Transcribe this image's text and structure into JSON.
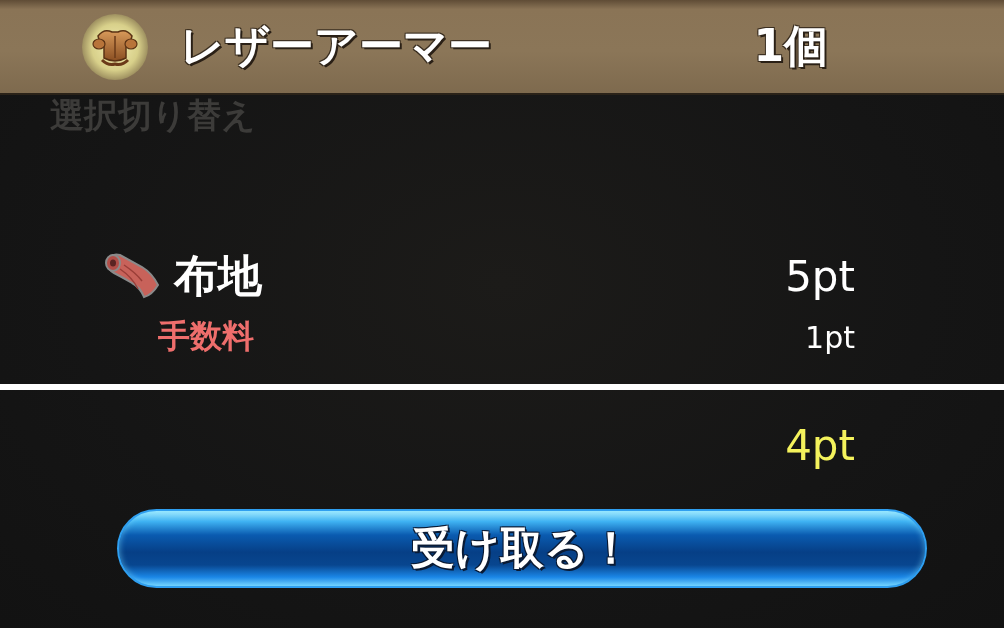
{
  "header": {
    "item_name": "レザーアーマー",
    "quantity": "1個"
  },
  "background_label": "選択切り替え",
  "materials": [
    {
      "name": "布地",
      "points": "5pt"
    }
  ],
  "fee": {
    "label": "手数料",
    "points": "1pt"
  },
  "total": {
    "points": "4pt"
  },
  "receive_button": {
    "label": "受け取る！"
  }
}
